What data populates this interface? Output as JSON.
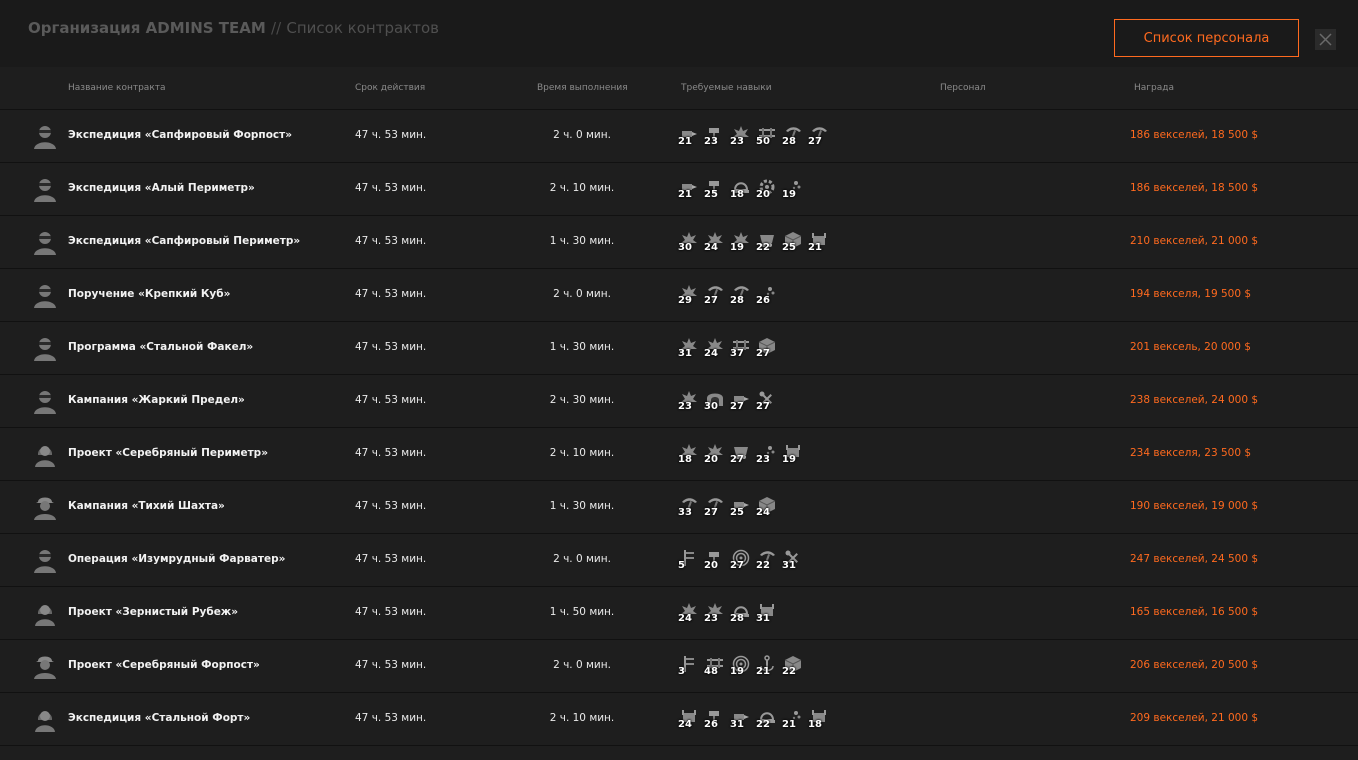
{
  "header": {
    "org": "Организация ADMINS TEAM",
    "separator": "//",
    "section": "Список контрактов",
    "staff_button": "Список персонала"
  },
  "columns": {
    "name": "Название контракта",
    "term": "Срок действия",
    "exec": "Время выполнения",
    "skills": "Требуемые навыки",
    "staff": "Персонал",
    "reward": "Награда"
  },
  "colors": {
    "accent": "#ff6a1f",
    "background": "#1e1e1e"
  },
  "contracts": [
    {
      "name": "Экспедиция «Сапфировый Форпост»",
      "term": "47 ч. 53 мин.",
      "exec": "2 ч. 0 мин.",
      "avatar": "masked-person-icon",
      "skills": [
        {
          "icon": "drill-icon",
          "level": "21"
        },
        {
          "icon": "sledge-icon",
          "level": "23"
        },
        {
          "icon": "blast-icon",
          "level": "23"
        },
        {
          "icon": "rail-icon",
          "level": "50"
        },
        {
          "icon": "pickaxe-icon",
          "level": "28"
        },
        {
          "icon": "pickaxe-icon",
          "level": "27"
        }
      ],
      "reward": "186 векселей, 18 500 $"
    },
    {
      "name": "Экспедиция «Алый Периметр»",
      "term": "47 ч. 53 мин.",
      "exec": "2 ч. 10 мин.",
      "avatar": "masked-person-icon",
      "skills": [
        {
          "icon": "drill-icon",
          "level": "21"
        },
        {
          "icon": "sledge-icon",
          "level": "25"
        },
        {
          "icon": "helmet-icon",
          "level": "18"
        },
        {
          "icon": "gear-icon",
          "level": "20"
        },
        {
          "icon": "spark-icon",
          "level": "19"
        }
      ],
      "reward": "186 векселей, 18 500 $"
    },
    {
      "name": "Экспедиция «Сапфировый Периметр»",
      "term": "47 ч. 53 мин.",
      "exec": "1 ч. 30 мин.",
      "avatar": "masked-person-icon",
      "skills": [
        {
          "icon": "blast-icon",
          "level": "30"
        },
        {
          "icon": "blast-icon",
          "level": "24"
        },
        {
          "icon": "blast-icon",
          "level": "19"
        },
        {
          "icon": "mine-cart-icon",
          "level": "22"
        },
        {
          "icon": "crate-icon",
          "level": "25"
        },
        {
          "icon": "cart-icon",
          "level": "21"
        }
      ],
      "reward": "210 векселей, 21 000 $"
    },
    {
      "name": "Поручение «Крепкий Куб»",
      "term": "47 ч. 53 мин.",
      "exec": "2 ч. 0 мин.",
      "avatar": "masked-person-icon",
      "skills": [
        {
          "icon": "blast-icon",
          "level": "29"
        },
        {
          "icon": "pickaxe-icon",
          "level": "27"
        },
        {
          "icon": "pickaxe-icon",
          "level": "28"
        },
        {
          "icon": "spark-icon",
          "level": "26"
        }
      ],
      "reward": "194 векселя, 19 500 $"
    },
    {
      "name": "Программа «Стальной Факел»",
      "term": "47 ч. 53 мин.",
      "exec": "1 ч. 30 мин.",
      "avatar": "masked-person-icon",
      "skills": [
        {
          "icon": "blast-icon",
          "level": "31"
        },
        {
          "icon": "blast-icon",
          "level": "24"
        },
        {
          "icon": "rail-icon",
          "level": "37"
        },
        {
          "icon": "crate-icon",
          "level": "27"
        }
      ],
      "reward": "201 вексель, 20 000 $"
    },
    {
      "name": "Кампания «Жаркий Предел»",
      "term": "47 ч. 53 мин.",
      "exec": "2 ч. 30 мин.",
      "avatar": "masked-person-icon",
      "skills": [
        {
          "icon": "blast-icon",
          "level": "23"
        },
        {
          "icon": "tunnel-icon",
          "level": "30"
        },
        {
          "icon": "drill-icon",
          "level": "27"
        },
        {
          "icon": "tools-icon",
          "level": "27"
        }
      ],
      "reward": "238 векселей, 24 000 $"
    },
    {
      "name": "Проект «Серебряный Периметр»",
      "term": "47 ч. 53 мин.",
      "exec": "2 ч. 10 мин.",
      "avatar": "female-person-icon",
      "skills": [
        {
          "icon": "blast-icon",
          "level": "18"
        },
        {
          "icon": "blast-icon",
          "level": "20"
        },
        {
          "icon": "mine-cart-icon",
          "level": "27"
        },
        {
          "icon": "spark-icon",
          "level": "23"
        },
        {
          "icon": "cart-icon",
          "level": "19"
        }
      ],
      "reward": "234 векселя, 23 500 $"
    },
    {
      "name": "Кампания «Тихий Шахта»",
      "term": "47 ч. 53 мин.",
      "exec": "1 ч. 30 мин.",
      "avatar": "helmet-person-icon",
      "skills": [
        {
          "icon": "pickaxe-icon",
          "level": "33"
        },
        {
          "icon": "pickaxe-icon",
          "level": "27"
        },
        {
          "icon": "drill-icon",
          "level": "25"
        },
        {
          "icon": "crate-icon",
          "level": "24"
        }
      ],
      "reward": "190 векселей, 19 000 $"
    },
    {
      "name": "Операция «Изумрудный Фарватер»",
      "term": "47 ч. 53 мин.",
      "exec": "2 ч. 0 мин.",
      "avatar": "masked-person-icon",
      "skills": [
        {
          "icon": "ladder-icon",
          "level": "5"
        },
        {
          "icon": "sledge-icon",
          "level": "20"
        },
        {
          "icon": "target-icon",
          "level": "27"
        },
        {
          "icon": "pickaxe-icon",
          "level": "22"
        },
        {
          "icon": "tools-icon",
          "level": "31"
        }
      ],
      "reward": "247 векселей, 24 500 $"
    },
    {
      "name": "Проект «Зернистый Рубеж»",
      "term": "47 ч. 53 мин.",
      "exec": "1 ч. 50 мин.",
      "avatar": "female-person-icon",
      "skills": [
        {
          "icon": "blast-icon",
          "level": "24"
        },
        {
          "icon": "blast-icon",
          "level": "23"
        },
        {
          "icon": "helmet-icon",
          "level": "28"
        },
        {
          "icon": "cart-icon",
          "level": "31"
        }
      ],
      "reward": "165 векселей, 16 500 $"
    },
    {
      "name": "Проект «Серебряный Форпост»",
      "term": "47 ч. 53 мин.",
      "exec": "2 ч. 0 мин.",
      "avatar": "helmet-person-icon",
      "skills": [
        {
          "icon": "ladder-icon",
          "level": "3"
        },
        {
          "icon": "rail-icon",
          "level": "48"
        },
        {
          "icon": "target-icon",
          "level": "19"
        },
        {
          "icon": "anchor-icon",
          "level": "21"
        },
        {
          "icon": "crate-icon",
          "level": "22"
        }
      ],
      "reward": "206 векселей, 20 500 $"
    },
    {
      "name": "Экспедиция «Стальной Форт»",
      "term": "47 ч. 53 мин.",
      "exec": "2 ч. 10 мин.",
      "avatar": "female-person-icon",
      "skills": [
        {
          "icon": "cart-icon",
          "level": "24"
        },
        {
          "icon": "sledge-icon",
          "level": "26"
        },
        {
          "icon": "drill-icon",
          "level": "31"
        },
        {
          "icon": "helmet-icon",
          "level": "22"
        },
        {
          "icon": "spark-icon",
          "level": "21"
        },
        {
          "icon": "cart-icon",
          "level": "18"
        }
      ],
      "reward": "209 векселей, 21 000 $"
    }
  ]
}
